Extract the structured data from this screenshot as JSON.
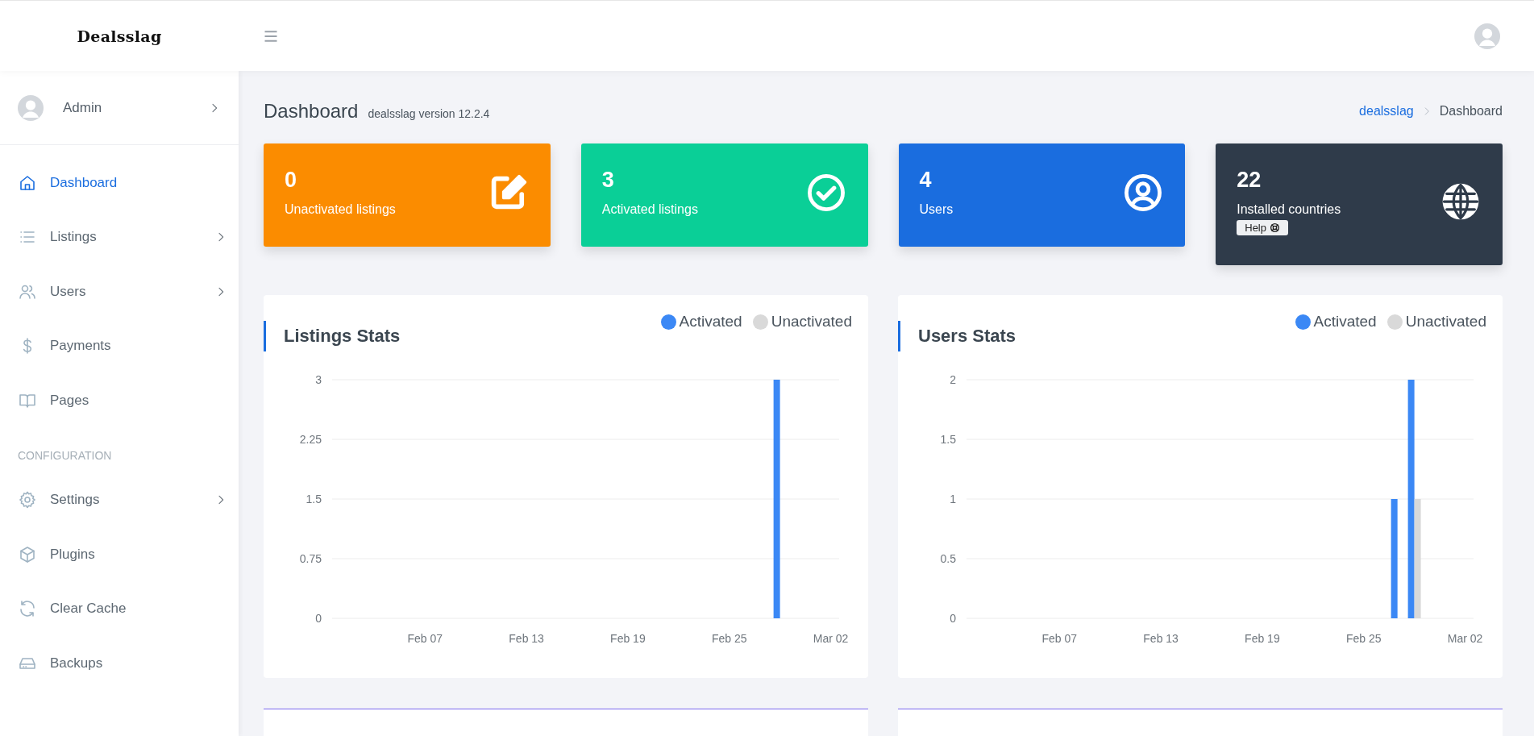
{
  "header": {
    "logo": "Dealsslag"
  },
  "sidebar": {
    "user": {
      "name": "Admin"
    },
    "sections": [
      {
        "items": [
          {
            "label": "Dashboard",
            "selected": true,
            "expandable": false
          },
          {
            "label": "Listings",
            "selected": false,
            "expandable": true
          },
          {
            "label": "Users",
            "selected": false,
            "expandable": true
          },
          {
            "label": "Payments",
            "selected": false,
            "expandable": false
          },
          {
            "label": "Pages",
            "selected": false,
            "expandable": false
          }
        ]
      },
      {
        "heading": "CONFIGURATION",
        "items": [
          {
            "label": "Settings",
            "selected": false,
            "expandable": true
          },
          {
            "label": "Plugins",
            "selected": false,
            "expandable": false
          },
          {
            "label": "Clear Cache",
            "selected": false,
            "expandable": false
          },
          {
            "label": "Backups",
            "selected": false,
            "expandable": false
          }
        ]
      }
    ]
  },
  "page": {
    "title": "Dashboard",
    "subtitle": "dealsslag version 12.2.4",
    "breadcrumb": [
      {
        "label": "dealsslag",
        "kind": "link"
      },
      {
        "label": "Dashboard",
        "kind": "current"
      }
    ]
  },
  "stat_cards": [
    {
      "value": "0",
      "label": "Unactivated listings",
      "color": "#fb8c00"
    },
    {
      "value": "3",
      "label": "Activated listings",
      "color": "#0acf97"
    },
    {
      "value": "4",
      "label": "Users",
      "color": "#1a6ddf"
    },
    {
      "value": "22",
      "label": "Installed countries",
      "color": "#2f3b4a",
      "button": "Help"
    }
  ],
  "charts": [
    {
      "title": "Listings Stats",
      "chart_data": {
        "type": "bar",
        "categories": [
          null,
          null,
          null,
          null,
          null,
          "Feb 07",
          null,
          null,
          null,
          null,
          null,
          "Feb 13",
          null,
          null,
          null,
          null,
          null,
          "Feb 19",
          null,
          null,
          null,
          null,
          null,
          "Feb 25",
          null,
          null,
          null,
          null,
          null,
          "Mar 02"
        ],
        "series": [
          {
            "name": "Activated",
            "color": "#3b88f5",
            "values": [
              0,
              0,
              0,
              0,
              0,
              0,
              0,
              0,
              0,
              0,
              0,
              0,
              0,
              0,
              0,
              0,
              0,
              0,
              0,
              0,
              0,
              0,
              0,
              0,
              0,
              0,
              3,
              0,
              0,
              0
            ]
          },
          {
            "name": "Unactivated",
            "color": "#d9d9d9",
            "values": [
              0,
              0,
              0,
              0,
              0,
              0,
              0,
              0,
              0,
              0,
              0,
              0,
              0,
              0,
              0,
              0,
              0,
              0,
              0,
              0,
              0,
              0,
              0,
              0,
              0,
              0,
              0,
              0,
              0,
              0
            ]
          }
        ],
        "ylim": [
          0,
          3
        ],
        "yticks": [
          0,
          0.75,
          1.5,
          2.25,
          3
        ],
        "grid": true
      }
    },
    {
      "title": "Users Stats",
      "chart_data": {
        "type": "bar",
        "categories": [
          null,
          null,
          null,
          null,
          null,
          "Feb 07",
          null,
          null,
          null,
          null,
          null,
          "Feb 13",
          null,
          null,
          null,
          null,
          null,
          "Feb 19",
          null,
          null,
          null,
          null,
          null,
          "Feb 25",
          null,
          null,
          null,
          null,
          null,
          "Mar 02"
        ],
        "series": [
          {
            "name": "Activated",
            "color": "#3b88f5",
            "values": [
              0,
              0,
              0,
              0,
              0,
              0,
              0,
              0,
              0,
              0,
              0,
              0,
              0,
              0,
              0,
              0,
              0,
              0,
              0,
              0,
              0,
              0,
              0,
              0,
              0,
              1,
              2,
              0,
              0,
              0
            ]
          },
          {
            "name": "Unactivated",
            "color": "#d9d9d9",
            "values": [
              0,
              0,
              0,
              0,
              0,
              0,
              0,
              0,
              0,
              0,
              0,
              0,
              0,
              0,
              0,
              0,
              0,
              0,
              0,
              0,
              0,
              0,
              0,
              0,
              0,
              0,
              1,
              0,
              0,
              0
            ]
          }
        ],
        "ylim": [
          0,
          2
        ],
        "yticks": [
          0,
          0.5,
          1,
          1.5,
          2
        ],
        "grid": true
      }
    }
  ]
}
